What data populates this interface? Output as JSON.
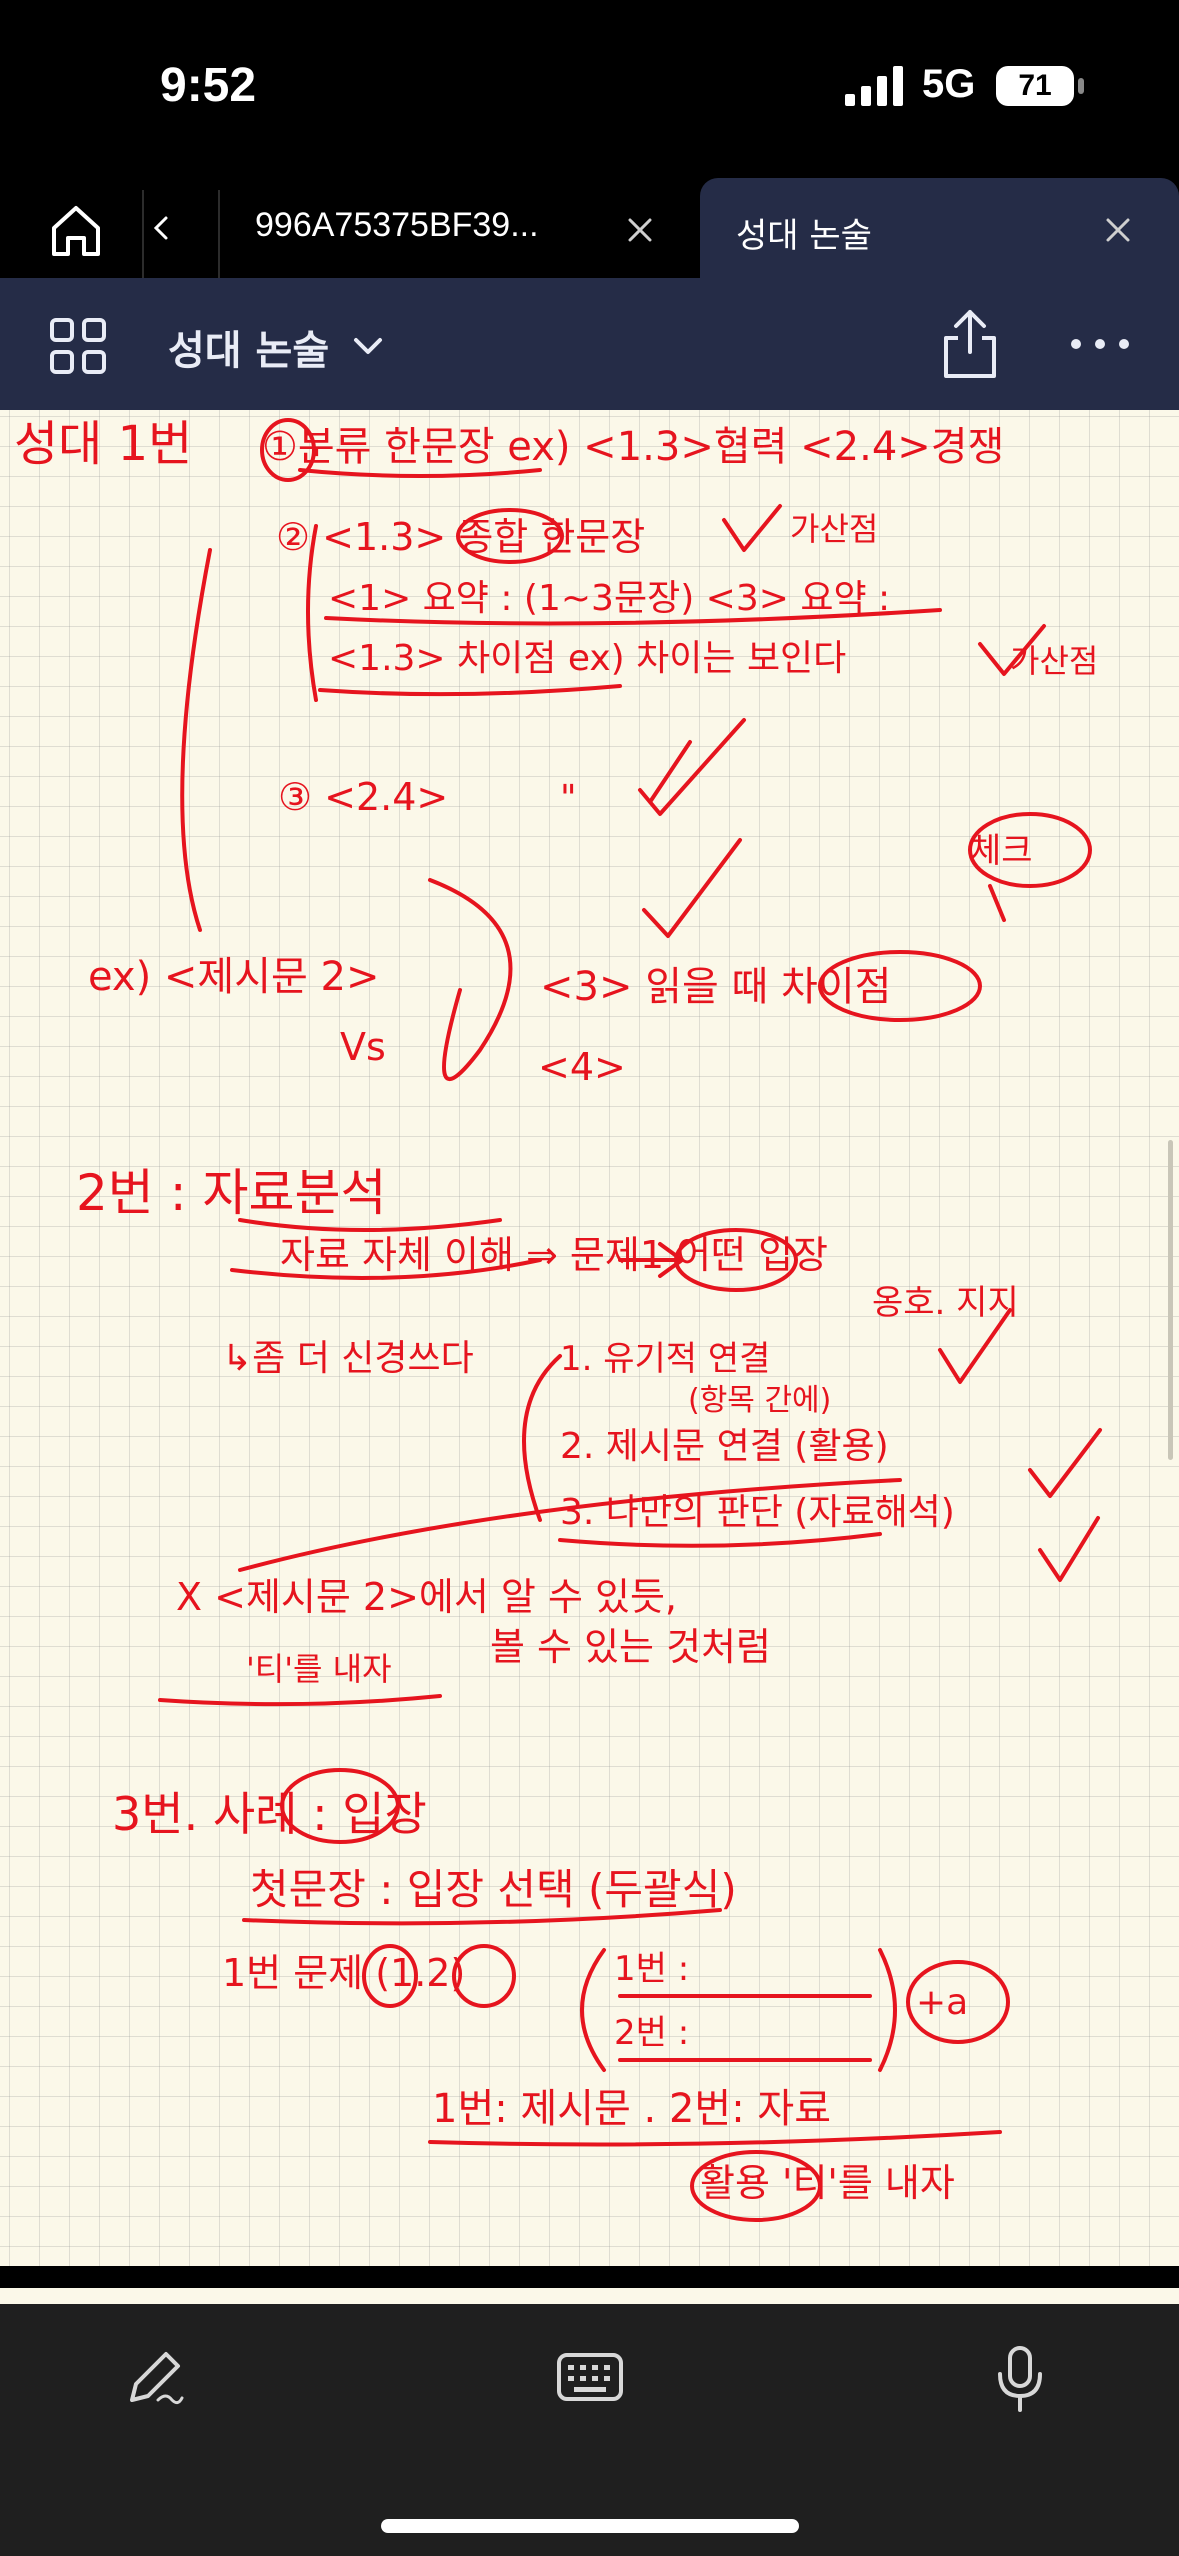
{
  "status_bar": {
    "time": "9:52",
    "network": "5G",
    "battery": "71"
  },
  "tabs": {
    "items": [
      {
        "title": "996A75375BF39...",
        "active": false
      },
      {
        "title": "성대 논술",
        "active": true
      }
    ]
  },
  "toolbar": {
    "document_title": "성대 논술"
  },
  "note": {
    "handwriting": [
      "성대 1번",
      "①분류 한문장 ex) <1.3>협력 <2.4>경쟁",
      "② <1.3> 종합 한문장",
      "가산점",
      "<1> 요약 : (1~3문장) <3> 요약 :",
      "<1.3> 차이점 ex) 차이는 보인다",
      "가산점",
      "③ <2.4>",
      "\"",
      "체크",
      "ex) <제시문 2>",
      "Vs",
      "<3> 읽을 때 차이점",
      "<4>",
      "2번 : 자료분석",
      "자료 자체 이해 ⇒ 문제1 어떤 입장",
      "옹호. 지지",
      "↳좀 더 신경쓰다",
      "1. 유기적 연결",
      "(항목 간에)",
      "2. 제시문 연결 (활용)",
      "3. 나만의 판단 (자료해석)",
      "X <제시문 2>에서 알 수 있듯,",
      "'티'를 내자",
      "볼 수 있는 것처럼",
      "3번. 사례 : 입장",
      "첫문장 : 입장 선택 (두괄식)",
      "1번 문제 (1.2)",
      "1번 :",
      "2번 :",
      "+a",
      "1번: 제시문 . 2번: 자료",
      "활용 '티'를 내자"
    ]
  },
  "bottom_bar": {
    "icons": [
      "pen-icon",
      "keyboard-icon",
      "microphone-icon"
    ]
  },
  "colors": {
    "ink": "#e6141e",
    "paper": "#fbf8e9",
    "toolbar": "#252c47"
  }
}
